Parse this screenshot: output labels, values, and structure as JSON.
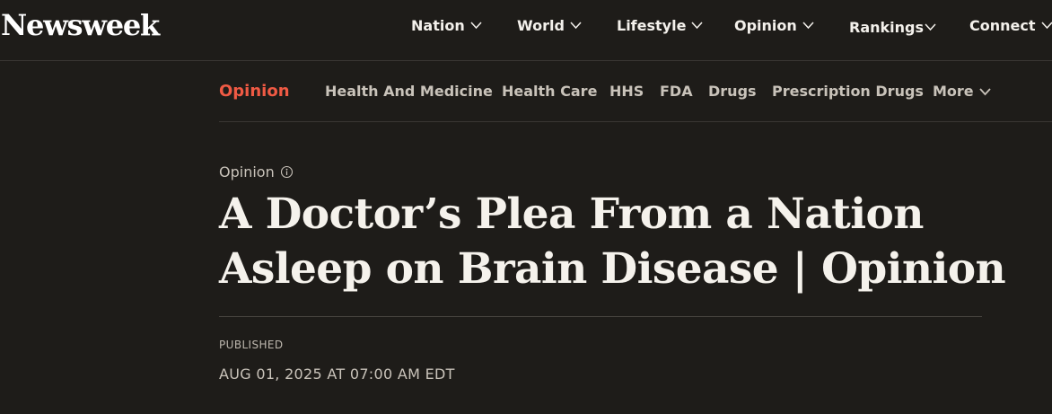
{
  "brand": {
    "logo_text": "Newsweek"
  },
  "main_nav": {
    "items": [
      {
        "label": "Nation"
      },
      {
        "label": "World"
      },
      {
        "label": "Lifestyle"
      },
      {
        "label": "Opinion"
      },
      {
        "label": "Rankings"
      },
      {
        "label": "Connect"
      }
    ]
  },
  "section_nav": {
    "active": "Opinion",
    "links": [
      {
        "label": "Health And Medicine"
      },
      {
        "label": "Health Care"
      },
      {
        "label": "HHS"
      },
      {
        "label": "FDA"
      },
      {
        "label": "Drugs"
      },
      {
        "label": "Prescription Drugs"
      },
      {
        "label": "More"
      }
    ]
  },
  "article": {
    "kicker": "Opinion",
    "kicker_icon": "info-icon",
    "headline": "A Doctor’s Plea From a Nation Asleep on Brain Disease | Opinion",
    "published_label": "PUBLISHED",
    "published_date": "AUG 01, 2025 AT 07:00 AM EDT"
  },
  "colors": {
    "background": "#1e1c19",
    "accent": "#f05a44",
    "text": "#f2eee8",
    "muted": "#c9c3ba"
  }
}
